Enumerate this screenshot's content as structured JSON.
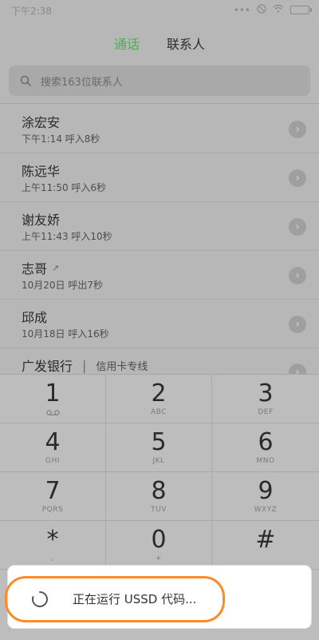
{
  "status": {
    "time": "下午2:38",
    "icons": [
      "more-icon",
      "mute-icon",
      "wifi-icon",
      "battery-icon"
    ]
  },
  "tabs": {
    "calls": "通话",
    "contacts": "联系人"
  },
  "search": {
    "placeholder": "搜索163位联系人"
  },
  "calls": [
    {
      "name": "涂宏安",
      "meta": "下午1:14 呼入8秒",
      "outgoing": false
    },
    {
      "name": "陈远华",
      "meta": "上午11:50 呼入6秒",
      "outgoing": false
    },
    {
      "name": "谢友娇",
      "meta": "上午11:43 呼入10秒",
      "outgoing": false
    },
    {
      "name": "志哥",
      "meta": "10月20日 呼出7秒",
      "outgoing": true
    },
    {
      "name": "邱成",
      "meta": "10月18日 呼入16秒",
      "outgoing": false
    }
  ],
  "partial_row": {
    "name": "广发银行",
    "separator": "|",
    "sub": "信用卡专线"
  },
  "keypad": [
    {
      "digit": "1",
      "sub": ""
    },
    {
      "digit": "2",
      "sub": "ABC"
    },
    {
      "digit": "3",
      "sub": "DEF"
    },
    {
      "digit": "4",
      "sub": "GHI"
    },
    {
      "digit": "5",
      "sub": "JKL"
    },
    {
      "digit": "6",
      "sub": "MNO"
    },
    {
      "digit": "7",
      "sub": "PQRS"
    },
    {
      "digit": "8",
      "sub": "TUV"
    },
    {
      "digit": "9",
      "sub": "WXYZ"
    },
    {
      "digit": "*",
      "sub": ","
    },
    {
      "digit": "0",
      "sub": "+"
    },
    {
      "digit": "#",
      "sub": ""
    }
  ],
  "toast": {
    "text": "正在运行 USSD 代码..."
  },
  "colors": {
    "accent_green": "#4caf50",
    "highlight_orange": "#ff8a2a"
  }
}
